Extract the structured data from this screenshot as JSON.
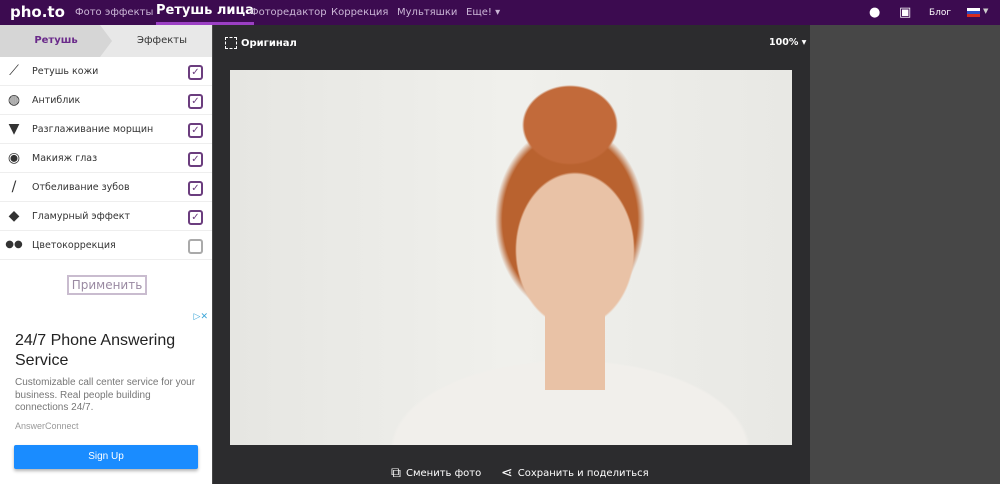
{
  "header": {
    "logo": "pho.to",
    "nav": [
      "Фото эффекты",
      "Ретушь лица",
      "Фоторедактор",
      "Коррекция",
      "Мультяшки",
      "Еще! ▾"
    ],
    "active": 1,
    "blog": "Блог"
  },
  "tabs": {
    "retouch": "Ретушь",
    "effects": "Эффекты"
  },
  "items": [
    {
      "label": "Ретушь кожи",
      "icon": "brush-icon",
      "checked": true
    },
    {
      "label": "Антиблик",
      "icon": "compact-icon",
      "checked": true
    },
    {
      "label": "Разглаживание морщин",
      "icon": "tube-icon",
      "checked": true
    },
    {
      "label": "Макияж глаз",
      "icon": "eye-icon",
      "checked": true
    },
    {
      "label": "Отбеливание зубов",
      "icon": "toothbrush-icon",
      "checked": true
    },
    {
      "label": "Гламурный эффект",
      "icon": "diamond-icon",
      "checked": true
    },
    {
      "label": "Цветокоррекция",
      "icon": "color-circles-icon",
      "checked": false
    }
  ],
  "apply": "Применить",
  "ad": {
    "title": "24/7 Phone Answering Service",
    "text": "Customizable call center service for your business. Real people building connections 24/7.",
    "brand": "AnswerConnect",
    "button": "Sign Up"
  },
  "toolbar": {
    "original": "Оригинал",
    "zoom": "100% ▾"
  },
  "actions": {
    "change": "Сменить фото",
    "share": "Сохранить и поделиться"
  },
  "colors": {
    "header": "#3c0b50",
    "accent": "#6b3d7e"
  }
}
